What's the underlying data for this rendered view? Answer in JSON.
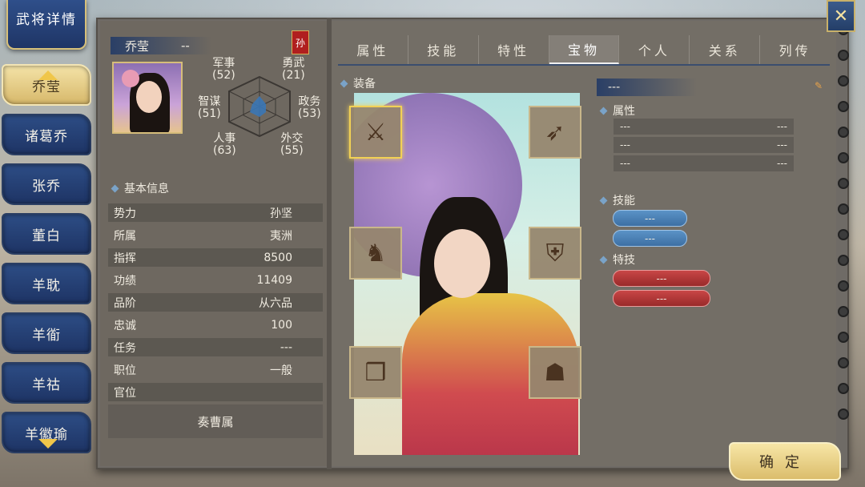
{
  "header": {
    "title": "武将详情",
    "close_icon": "crossed-swords-icon"
  },
  "characters": [
    {
      "label": "乔莹",
      "active": true
    },
    {
      "label": "诸葛乔",
      "active": false
    },
    {
      "label": "张乔",
      "active": false
    },
    {
      "label": "董白",
      "active": false
    },
    {
      "label": "羊耽",
      "active": false
    },
    {
      "label": "羊衜",
      "active": false
    },
    {
      "label": "羊祜",
      "active": false
    },
    {
      "label": "羊徽瑜",
      "active": false
    }
  ],
  "profile": {
    "name": "乔莹",
    "name_suffix": "--",
    "faction_flag": "孙"
  },
  "stats": {
    "military": {
      "label": "军事",
      "value": "(52)"
    },
    "valor": {
      "label": "勇武",
      "value": "(21)"
    },
    "strategy": {
      "label": "智谋",
      "value": "(51)"
    },
    "politics": {
      "label": "政务",
      "value": "(53)"
    },
    "personnel": {
      "label": "人事",
      "value": "(63)"
    },
    "diplomacy": {
      "label": "外交",
      "value": "(55)"
    }
  },
  "basic_info": {
    "title": "基本信息",
    "rows": [
      {
        "label": "势力",
        "value": "孙坚"
      },
      {
        "label": "所属",
        "value": "夷洲"
      },
      {
        "label": "指挥",
        "value": "8500"
      },
      {
        "label": "功绩",
        "value": "11409"
      },
      {
        "label": "品阶",
        "value": "从六品"
      },
      {
        "label": "忠诚",
        "value": "100"
      },
      {
        "label": "任务",
        "value": "---"
      },
      {
        "label": "职位",
        "value": "一般"
      },
      {
        "label": "官位",
        "value": ""
      }
    ],
    "memorial_button": "奏曹属"
  },
  "tabs": [
    {
      "label": "属性",
      "active": false
    },
    {
      "label": "技能",
      "active": false
    },
    {
      "label": "特性",
      "active": false
    },
    {
      "label": "宝物",
      "active": true
    },
    {
      "label": "个人",
      "active": false
    },
    {
      "label": "关系",
      "active": false
    },
    {
      "label": "列传",
      "active": false
    }
  ],
  "equipment": {
    "title": "装备",
    "slots": [
      {
        "name": "weapon-slot",
        "icon": "halberd-icon",
        "glyph": "⚔"
      },
      {
        "name": "bow-slot",
        "icon": "bow-icon",
        "glyph": "➶"
      },
      {
        "name": "horse-slot",
        "icon": "horse-icon",
        "glyph": "♞"
      },
      {
        "name": "armor-slot",
        "icon": "armor-icon",
        "glyph": "⛨"
      },
      {
        "name": "scroll-slot",
        "icon": "scroll-icon",
        "glyph": "❒"
      },
      {
        "name": "treasure-slot",
        "icon": "treasure-icon",
        "glyph": "☗"
      }
    ]
  },
  "detail": {
    "header": "---",
    "attributes_title": "属性",
    "attributes": [
      {
        "left": "---",
        "right": "---"
      },
      {
        "left": "---",
        "right": "---"
      },
      {
        "left": "---",
        "right": "---"
      }
    ],
    "skills_title": "技能",
    "skills": [
      "---",
      "---"
    ],
    "specials_title": "特技",
    "specials": [
      "---",
      "---"
    ]
  },
  "confirm_button": "确定",
  "colors": {
    "accent_blue": "#2d4d85",
    "gold": "#dbbd6c",
    "special_red": "#c84646",
    "skill_blue": "#5b93c7"
  }
}
